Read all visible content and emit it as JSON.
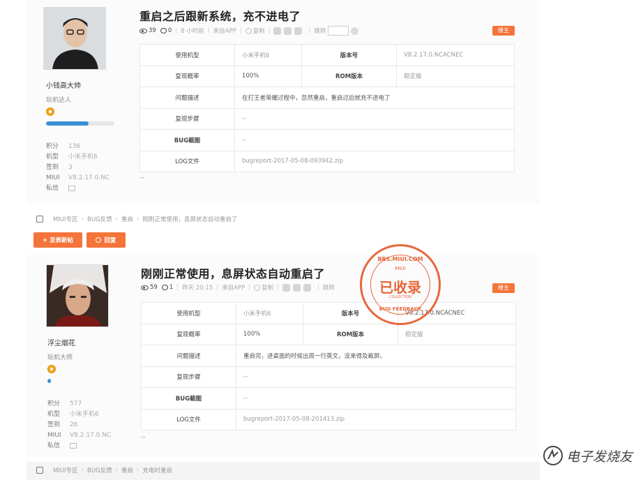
{
  "post1": {
    "user": {
      "name": "小钱高大帅",
      "rank": "玩机达人",
      "level": 0.62,
      "stats": [
        {
          "k": "积分",
          "v": "136"
        },
        {
          "k": "机型",
          "v": "小米手机6"
        },
        {
          "k": "签到",
          "v": "3"
        },
        {
          "k": "MIUI",
          "v": "V8.2.17.0.NC"
        },
        {
          "k": "私信",
          "v": ""
        }
      ]
    },
    "title": "重启之后跟新系统，充不进电了",
    "views": "39",
    "replies": "0",
    "time": "8 小时前",
    "from": "来自APP",
    "copy": "复制",
    "jump": "跳转",
    "badge": "楼主",
    "rows": [
      {
        "k": "使用机型",
        "v": "小米手机6",
        "k2": "版本号",
        "v2": "V8.2.17.0.NCACNEC"
      },
      {
        "k": "复现概率",
        "v": "100%",
        "k2": "ROM版本",
        "v2": "稳定版"
      },
      {
        "k": "问题描述",
        "v": "在打王者荣耀过程中，忽然重启，重启过后就充不进电了"
      },
      {
        "k": "复现步骤",
        "v": "--"
      },
      {
        "k": "BUG截图",
        "v": "--"
      },
      {
        "k": "LOG文件",
        "v": "bugreport-2017-05-08-093942.zip"
      }
    ],
    "footer": "--"
  },
  "breadcrumb1": [
    "MIUI专区",
    "BUG反馈",
    "重启",
    "刚刚正常使用，息屏状态自动重启了"
  ],
  "actions": {
    "new_post": "+ 发表新帖",
    "reply": "回复"
  },
  "post2": {
    "user": {
      "name": "浮尘烟花",
      "rank": "玩机大师",
      "level": 0.05,
      "stats": [
        {
          "k": "积分",
          "v": "577"
        },
        {
          "k": "机型",
          "v": "小米手机6"
        },
        {
          "k": "签到",
          "v": "26"
        },
        {
          "k": "MIUI",
          "v": "V8.2.17.0.NC"
        },
        {
          "k": "私信",
          "v": ""
        }
      ]
    },
    "title": "刚刚正常使用，息屏状态自动重启了",
    "views": "59",
    "replies": "1",
    "time": "昨天 20:15",
    "from": "来自APP",
    "copy": "复制",
    "jump": "跳转",
    "badge": "楼主",
    "rows": [
      {
        "k": "使用机型",
        "v": "小米手机6",
        "k2": "版本号",
        "v2": "V8.2.17.0.NCACNEC"
      },
      {
        "k": "复现概率",
        "v": "100%",
        "k2": "ROM版本",
        "v2": "稳定版"
      },
      {
        "k": "问题描述",
        "v": "重启完，进桌面的时候出现一行英文，没来得及截屏。"
      },
      {
        "k": "复现步骤",
        "v": "--"
      },
      {
        "k": "BUG截图",
        "v": "--"
      },
      {
        "k": "LOG文件",
        "v": "bugreport-2017-05-08-201413.zip"
      }
    ],
    "footer": "--"
  },
  "stamp": {
    "top": "BBS.MIUI.COM",
    "mid": "MIUI",
    "main": "已收录",
    "sub": "COLLECTION",
    "bottom": "BUG FEEDBACK"
  },
  "breadcrumb2": [
    "MIUI专区",
    "BUG反馈",
    "重启",
    "充电时重启"
  ],
  "watermark": "电子发烧友",
  "colors": {
    "accent": "#f4743a",
    "level_bar": "#3c8fd6"
  }
}
